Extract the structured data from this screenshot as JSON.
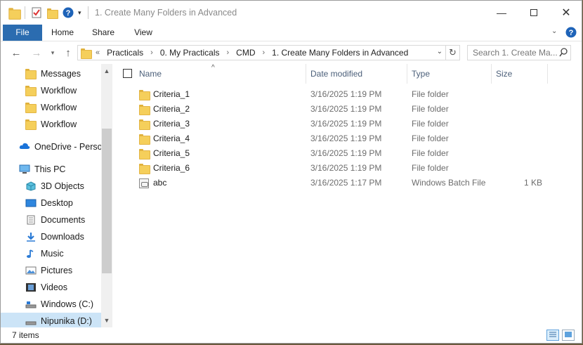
{
  "window": {
    "title": "1. Create Many Folders in Advanced",
    "minimize_icon": "minimize-icon",
    "maximize_icon": "maximize-icon",
    "close_icon": "close-icon"
  },
  "ribbon": {
    "tabs": [
      {
        "label": "File"
      },
      {
        "label": "Home"
      },
      {
        "label": "Share"
      },
      {
        "label": "View"
      }
    ],
    "accent": "#2b6cb0"
  },
  "address": {
    "overflow": "«",
    "crumbs": [
      "Practicals",
      "0. My Practicals",
      "CMD",
      "1. Create Many Folders in Advanced"
    ]
  },
  "search": {
    "placeholder": "Search 1. Create Ma..."
  },
  "nav": {
    "items": [
      {
        "label": "Messages",
        "icon": "folder-icon"
      },
      {
        "label": "Workflow",
        "icon": "folder-icon"
      },
      {
        "label": "Workflow",
        "icon": "folder-icon"
      },
      {
        "label": "Workflow",
        "icon": "folder-icon"
      },
      {
        "label": "OneDrive - Personal",
        "icon": "cloud-icon"
      },
      {
        "label": "This PC",
        "icon": "computer-icon"
      },
      {
        "label": "3D Objects",
        "icon": "cube-icon"
      },
      {
        "label": "Desktop",
        "icon": "desktop-icon"
      },
      {
        "label": "Documents",
        "icon": "documents-icon"
      },
      {
        "label": "Downloads",
        "icon": "download-icon"
      },
      {
        "label": "Music",
        "icon": "music-icon"
      },
      {
        "label": "Pictures",
        "icon": "pictures-icon"
      },
      {
        "label": "Videos",
        "icon": "videos-icon"
      },
      {
        "label": "Windows (C:)",
        "icon": "drive-icon"
      },
      {
        "label": "Nipunika (D:)",
        "icon": "drive-icon"
      }
    ]
  },
  "table": {
    "columns": [
      "Name",
      "Date modified",
      "Type",
      "Size"
    ],
    "rows": [
      {
        "name": "Criteria_1",
        "date": "3/16/2025 1:19 PM",
        "type": "File folder",
        "size": ""
      },
      {
        "name": "Criteria_2",
        "date": "3/16/2025 1:19 PM",
        "type": "File folder",
        "size": ""
      },
      {
        "name": "Criteria_3",
        "date": "3/16/2025 1:19 PM",
        "type": "File folder",
        "size": ""
      },
      {
        "name": "Criteria_4",
        "date": "3/16/2025 1:19 PM",
        "type": "File folder",
        "size": ""
      },
      {
        "name": "Criteria_5",
        "date": "3/16/2025 1:19 PM",
        "type": "File folder",
        "size": ""
      },
      {
        "name": "Criteria_6",
        "date": "3/16/2025 1:19 PM",
        "type": "File folder",
        "size": ""
      },
      {
        "name": "abc",
        "date": "3/16/2025 1:17 PM",
        "type": "Windows Batch File",
        "size": "1 KB"
      }
    ]
  },
  "status": {
    "count": "7 items"
  }
}
